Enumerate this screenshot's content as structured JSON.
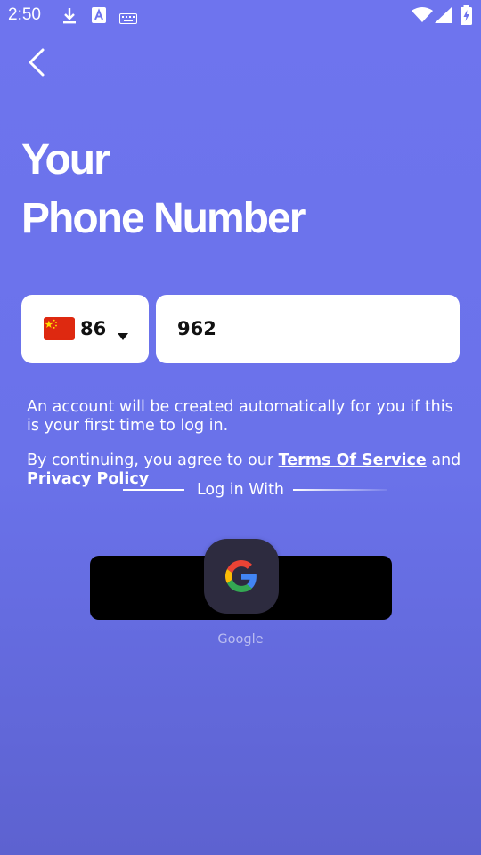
{
  "status_bar": {
    "time": "2:50",
    "left_icons": [
      "download-icon",
      "font-icon",
      "keyboard-icon"
    ],
    "right_icons": [
      "wifi-icon",
      "signal-icon",
      "battery-icon"
    ]
  },
  "header": {
    "back_icon": "chevron-left-icon"
  },
  "title": {
    "line1": "Your",
    "line2": "Phone Number"
  },
  "form": {
    "country_code": "86",
    "country_flag": "china-flag",
    "phone_value": "962"
  },
  "notice": {
    "auto_create": "An account will be created automatically for you if this is your first time to log in.",
    "agree_prefix": "By continuing, you agree to our ",
    "terms_label": "Terms Of Service",
    "and_text": " and",
    "privacy_label": "Privacy Policy"
  },
  "login": {
    "divider_text": "Log in With",
    "google_label": "Google"
  },
  "colors": {
    "background": "#6e74ee",
    "google_button": "#2d2b3f",
    "input_bg": "#ffffff"
  }
}
